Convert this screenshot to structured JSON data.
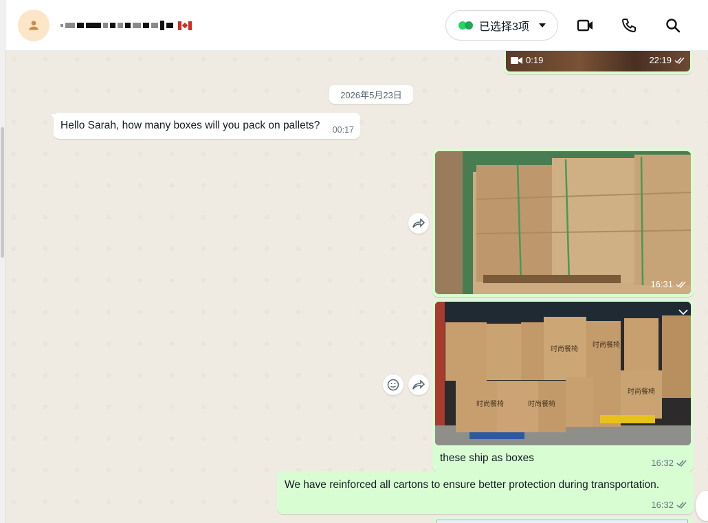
{
  "header": {
    "select_label": "已选择3项",
    "icons": [
      "person-icon",
      "video-call-icon",
      "voice-call-icon",
      "search-icon"
    ]
  },
  "chat": {
    "top_video": {
      "duration": "0:19",
      "time": "22:19"
    },
    "date_divider": "2026年5月23日",
    "incoming": [
      {
        "text": "Hello Sarah, how many boxes will you pack on pallets?",
        "time": "00:17"
      }
    ],
    "outgoing": [
      {
        "type": "image",
        "time": "16:31"
      },
      {
        "type": "image",
        "caption": "these ship as boxes",
        "time": "16:32"
      },
      {
        "type": "text",
        "text": "We have reinforced all cartons to ensure better protection during transportation.",
        "time": "16:32"
      }
    ],
    "carton_label": "时尚餐椅"
  },
  "colors": {
    "chat_background": "#efeae2",
    "outgoing_bubble": "#d9fdd3",
    "incoming_bubble": "#ffffff",
    "accent_green": "#25d366",
    "header_background": "#ffffff"
  }
}
